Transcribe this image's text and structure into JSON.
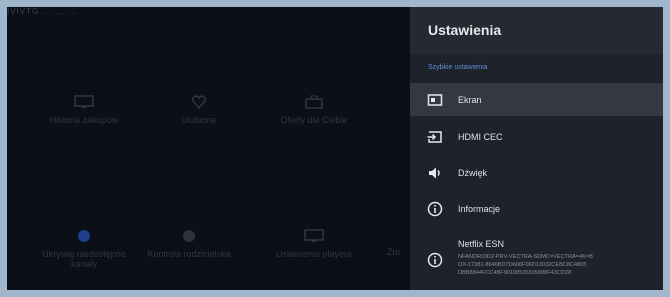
{
  "settings": {
    "title": "Ustawienia",
    "quick_label": "Szybkie ustawienia",
    "items": [
      {
        "label": "Ekran",
        "icon": "screen-icon"
      },
      {
        "label": "HDMI CEC",
        "icon": "hdmi-input-icon"
      },
      {
        "label": "Dźwięk",
        "icon": "speaker-icon"
      },
      {
        "label": "Informacje",
        "icon": "info-icon"
      }
    ],
    "netflix": {
      "label": "Netflix ESN",
      "esn_lines": [
        "NFANDROID2-PRV-VECTRA-SDMC=VECTRA=4K=B",
        "OX-17381-8646BD7D606F06D13032CEBC8C4805",
        "DBB8844FCC4BF90108536505888F43CD28"
      ],
      "icon": "info-icon"
    }
  },
  "background": {
    "topbar_text": "IVIVTG   ...   ...   ...",
    "tiles": [
      {
        "label": "Historia zakupów",
        "icon": "monitor-icon"
      },
      {
        "label": "Ulubione",
        "icon": "heart-icon"
      },
      {
        "label": "Oferty dla Ciebie",
        "icon": "briefcase-icon"
      },
      {
        "label": "Ukrywaj niedostępne kanały",
        "icon": "toggle-dot-icon"
      },
      {
        "label": "Kontrola rodzicielska",
        "icon": "toggle-dot-icon"
      },
      {
        "label": "Ustawienia playera",
        "icon": "monitor-icon"
      },
      {
        "label": "Zm",
        "icon": "partial-tile"
      }
    ]
  },
  "colors": {
    "panel_bg": "#1e232b",
    "header_bg": "#252a32",
    "accent": "#5d8fd6",
    "selected_bg": "#333842",
    "outer_bg": "#9fb6cc"
  }
}
